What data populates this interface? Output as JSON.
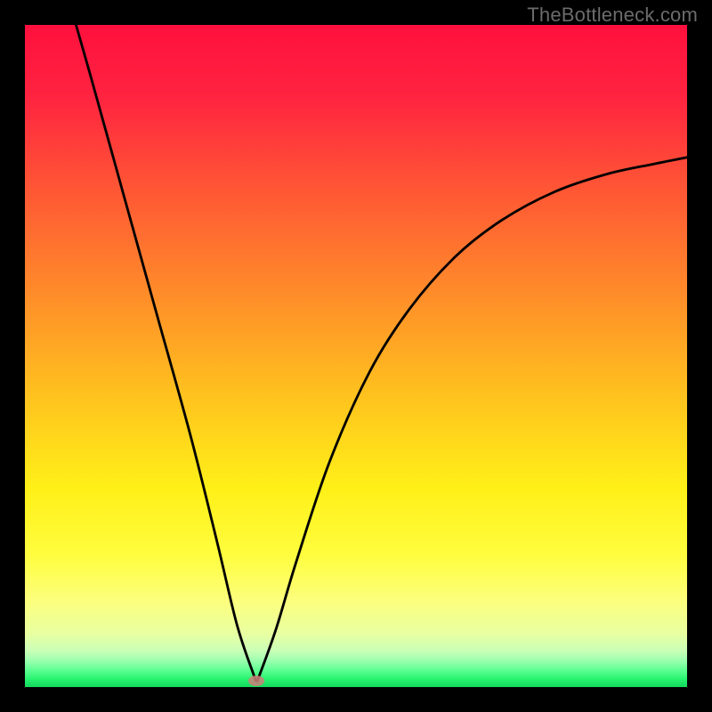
{
  "watermark": "TheBottleneck.com",
  "chart_data": {
    "type": "line",
    "title": "",
    "xlabel": "",
    "ylabel": "",
    "xlim": [
      0,
      1
    ],
    "ylim": [
      0,
      1
    ],
    "series": [
      {
        "name": "bottleneck-curve",
        "x": [
          0.06,
          0.1,
          0.15,
          0.2,
          0.25,
          0.29,
          0.32,
          0.345,
          0.35,
          0.355,
          0.38,
          0.41,
          0.46,
          0.52,
          0.58,
          0.65,
          0.72,
          0.8,
          0.88,
          0.95,
          1.0
        ],
        "y": [
          1.06,
          0.92,
          0.74,
          0.56,
          0.38,
          0.22,
          0.095,
          0.02,
          0.01,
          0.02,
          0.09,
          0.19,
          0.34,
          0.475,
          0.57,
          0.65,
          0.705,
          0.748,
          0.775,
          0.79,
          0.8
        ]
      }
    ],
    "annotations": [
      {
        "name": "min-marker",
        "x": 0.35,
        "y": 0.01
      }
    ],
    "background_gradient": {
      "stops": [
        {
          "pos": 0.0,
          "color": "#ff103e"
        },
        {
          "pos": 0.11,
          "color": "#ff2440"
        },
        {
          "pos": 0.23,
          "color": "#ff5036"
        },
        {
          "pos": 0.4,
          "color": "#ff8a2a"
        },
        {
          "pos": 0.56,
          "color": "#ffc21e"
        },
        {
          "pos": 0.7,
          "color": "#fff018"
        },
        {
          "pos": 0.8,
          "color": "#fffd3e"
        },
        {
          "pos": 0.87,
          "color": "#fcff7d"
        },
        {
          "pos": 0.92,
          "color": "#e8ffa2"
        },
        {
          "pos": 0.945,
          "color": "#caffb7"
        },
        {
          "pos": 0.96,
          "color": "#9cffaf"
        },
        {
          "pos": 0.974,
          "color": "#5fff93"
        },
        {
          "pos": 0.988,
          "color": "#27f36f"
        },
        {
          "pos": 1.0,
          "color": "#13d85d"
        }
      ]
    }
  }
}
